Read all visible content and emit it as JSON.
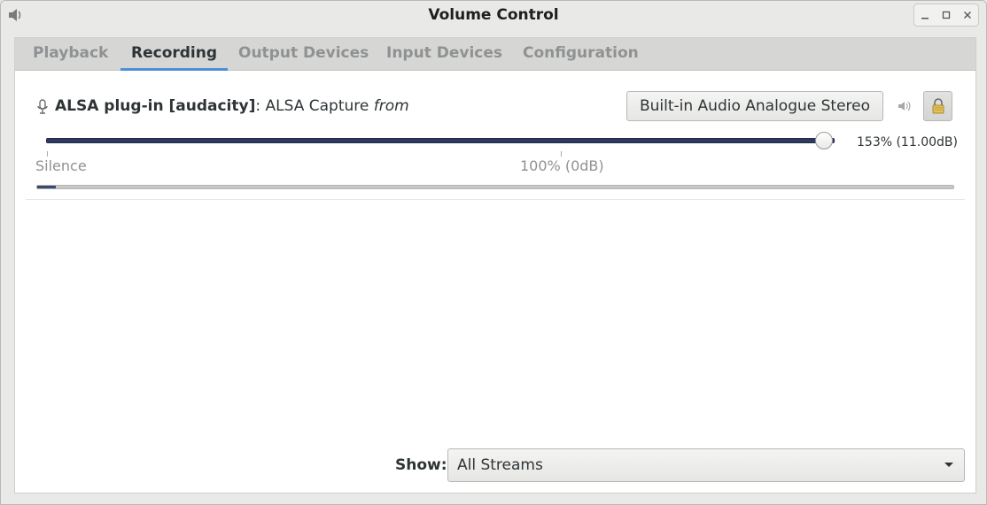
{
  "window": {
    "title": "Volume Control",
    "app_icon": "speaker-icon"
  },
  "tabs": [
    {
      "label": "Playback",
      "active": false
    },
    {
      "label": "Recording",
      "active": true
    },
    {
      "label": "Output Devices",
      "active": false
    },
    {
      "label": "Input Devices",
      "active": false
    },
    {
      "label": "Configuration",
      "active": false
    }
  ],
  "stream": {
    "icon": "microphone-icon",
    "name": "ALSA plug-in [audacity]",
    "separator": ": ",
    "description": "ALSA Capture ",
    "from_text": "from",
    "device_button": "Built-in Audio Analogue Stereo",
    "volume_readout": "153% (11.00dB)",
    "volume_fraction": 1.0,
    "level_fraction": 0.002,
    "tick_silence": "Silence",
    "tick_100": "100% (0dB)"
  },
  "footer": {
    "show_label": "Show:",
    "show_value": "All Streams"
  },
  "colors": {
    "accent": "#4a90d9",
    "slider": "#2d3a5c",
    "lock": "#e5c15a"
  }
}
